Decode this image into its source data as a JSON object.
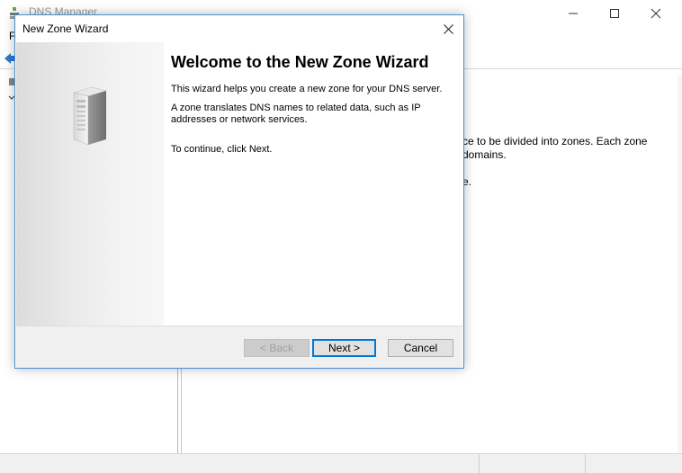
{
  "background_window": {
    "title": "DNS Manager",
    "menu_first_letter": "F",
    "content_line1": "ce to be divided into zones. Each zone",
    "content_line2": "domains.",
    "content_line3": "e."
  },
  "wizard": {
    "title": "New Zone Wizard",
    "heading": "Welcome to the New Zone Wizard",
    "paragraph1": "This wizard helps you create a new zone for your DNS server.",
    "paragraph2": "A zone translates DNS names to related data, such as IP addresses or network services.",
    "paragraph3": "To continue, click Next.",
    "buttons": {
      "back": "< Back",
      "next": "Next >",
      "cancel": "Cancel"
    },
    "back_enabled": false
  },
  "colors": {
    "dialog_border": "#4a8ed8",
    "default_button_border": "#0078d7",
    "link": "#1a5fb4"
  },
  "icons": [
    "dns-app-icon",
    "back-arrow-icon",
    "minimize-icon",
    "maximize-icon",
    "close-icon",
    "dialog-close-icon",
    "server-tower-icon",
    "tree-node-icon"
  ]
}
